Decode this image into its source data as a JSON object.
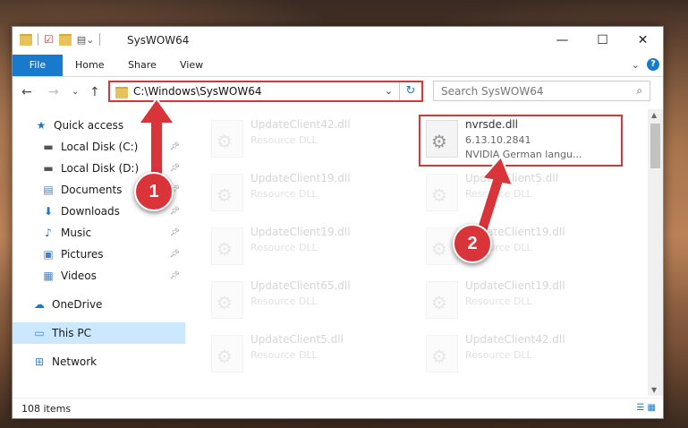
{
  "window": {
    "title": "SysWOW64",
    "controls": {
      "minimize": "—",
      "maximize": "☐",
      "close": "✕"
    }
  },
  "ribbon": {
    "tabs": [
      {
        "label": "File"
      },
      {
        "label": "Home"
      },
      {
        "label": "Share"
      },
      {
        "label": "View"
      }
    ],
    "collapse": "⌄",
    "help": "?"
  },
  "nav": {
    "back": "←",
    "forward": "→",
    "recent": "⌄",
    "up": "↑",
    "address": "C:\\Windows\\SysWOW64",
    "refresh": "↻",
    "search_placeholder": "Search SysWOW64"
  },
  "sidebar": {
    "items": [
      {
        "label": "Quick access",
        "icon": "star-icon",
        "glyph": "★",
        "color": "#1979ca"
      },
      {
        "label": "Local Disk (C:)",
        "icon": "drive-icon",
        "glyph": "▬",
        "color": "#555"
      },
      {
        "label": "Local Disk (D:)",
        "icon": "drive-icon",
        "glyph": "▬",
        "color": "#555"
      },
      {
        "label": "Documents",
        "icon": "documents-icon",
        "glyph": "▤",
        "color": "#4a7fc1"
      },
      {
        "label": "Downloads",
        "icon": "download-icon",
        "glyph": "⬇",
        "color": "#1979ca"
      },
      {
        "label": "Music",
        "icon": "music-icon",
        "glyph": "♪",
        "color": "#1979ca"
      },
      {
        "label": "Pictures",
        "icon": "pictures-icon",
        "glyph": "▣",
        "color": "#4a7fc1"
      },
      {
        "label": "Videos",
        "icon": "videos-icon",
        "glyph": "▦",
        "color": "#4a7fc1"
      },
      {
        "label": "OneDrive",
        "icon": "cloud-icon",
        "glyph": "☁",
        "color": "#1979ca"
      },
      {
        "label": "This PC",
        "icon": "computer-icon",
        "glyph": "▭",
        "color": "#3a8ad4"
      },
      {
        "label": "Network",
        "icon": "network-icon",
        "glyph": "⊞",
        "color": "#3a8ad4"
      }
    ]
  },
  "files": {
    "left": [
      {
        "name": "UpdateClient42.dll",
        "type": "Resource DLL"
      },
      {
        "name": "UpdateClient19.dll",
        "type": "Resource DLL"
      },
      {
        "name": "UpdateClient19.dll",
        "type": "Resource DLL"
      },
      {
        "name": "UpdateClient65.dll",
        "type": "Resource DLL"
      },
      {
        "name": "UpdateClient5.dll",
        "type": "Resource DLL"
      }
    ],
    "right": [
      {
        "name": "nvrsde.dll",
        "type": "6.13.10.2841",
        "desc": "NVIDIA German langu..."
      },
      {
        "name": "UpdateClient5.dll",
        "type": "Resource DLL"
      },
      {
        "name": "UpdateClient19.dll",
        "type": "Resource DLL"
      },
      {
        "name": "UpdateClient19.dll",
        "type": "Resource DLL"
      },
      {
        "name": "UpdateClient42.dll",
        "type": "Resource DLL"
      }
    ]
  },
  "annotations": {
    "step1": "1",
    "step2": "2",
    "accent": "#d9343a"
  },
  "status": {
    "items": "108 items"
  }
}
